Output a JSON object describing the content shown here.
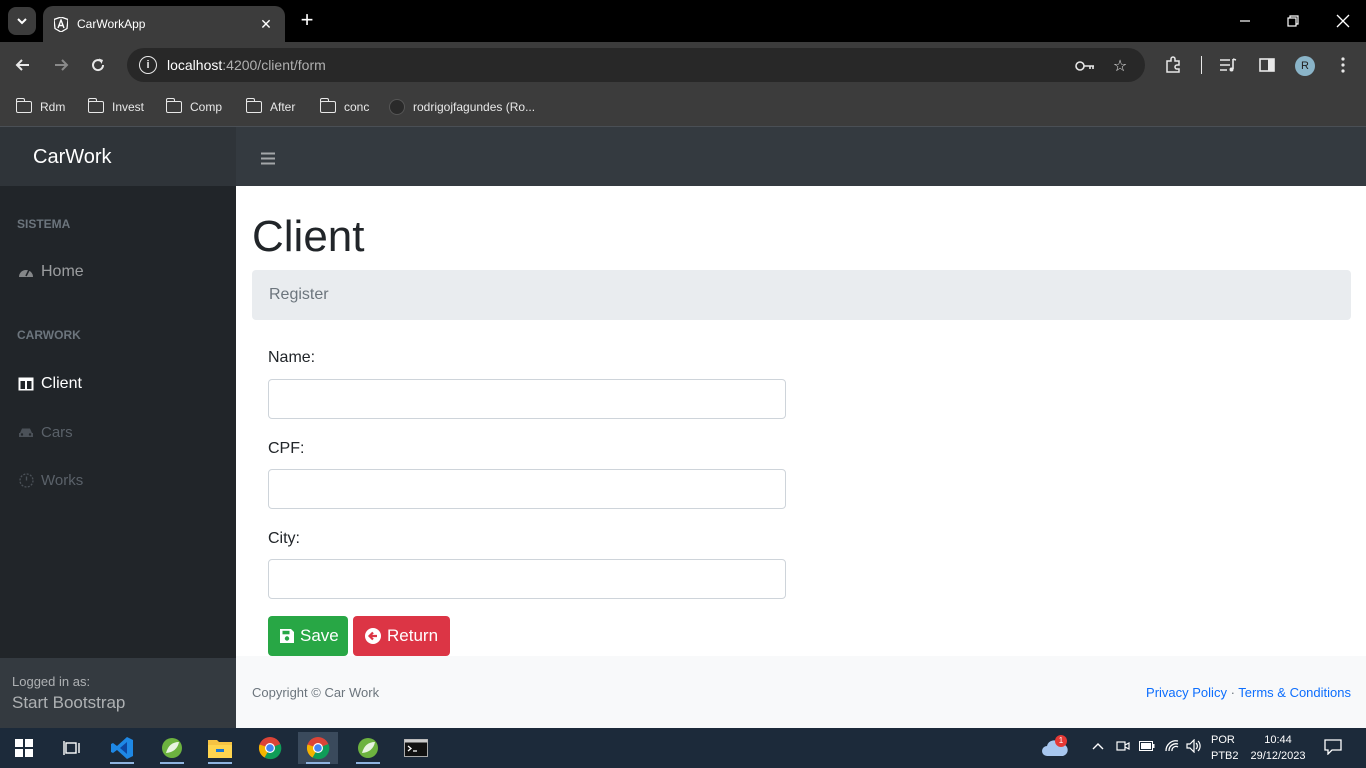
{
  "browser": {
    "tab_title": "CarWorkApp",
    "url_host": "localhost",
    "url_path": ":4200/client/form",
    "profile_initial": "R",
    "bookmarks": [
      "Rdm",
      "Invest",
      "Comp",
      "After",
      "conc",
      "rodrigojfagundes (Ro..."
    ]
  },
  "app": {
    "brand": "CarWork"
  },
  "sidebar": {
    "heading_sistema": "SISTEMA",
    "home": "Home",
    "heading_carwork": "CARWORK",
    "client": "Client",
    "cars": "Cars",
    "works": "Works",
    "logged_in_label": "Logged in as:",
    "logged_in_user": "Start Bootstrap"
  },
  "main": {
    "title": "Client",
    "breadcrumb": "Register",
    "fields": {
      "name_label": "Name:",
      "name_value": "",
      "cpf_label": "CPF:",
      "cpf_value": "",
      "city_label": "City:",
      "city_value": ""
    },
    "save_label": "Save",
    "return_label": "Return"
  },
  "footer": {
    "copyright": "Copyright © Car Work",
    "privacy": "Privacy Policy",
    "separator": " · ",
    "terms": "Terms & Conditions"
  },
  "taskbar": {
    "notification_count": "1",
    "lang_line1": "POR",
    "lang_line2": "PTB2",
    "time": "10:44",
    "date": "29/12/2023"
  },
  "colors": {
    "save": "#28a745",
    "return": "#dc3545",
    "sidebar_bg": "#212529",
    "navbar_bg": "#343a40"
  }
}
